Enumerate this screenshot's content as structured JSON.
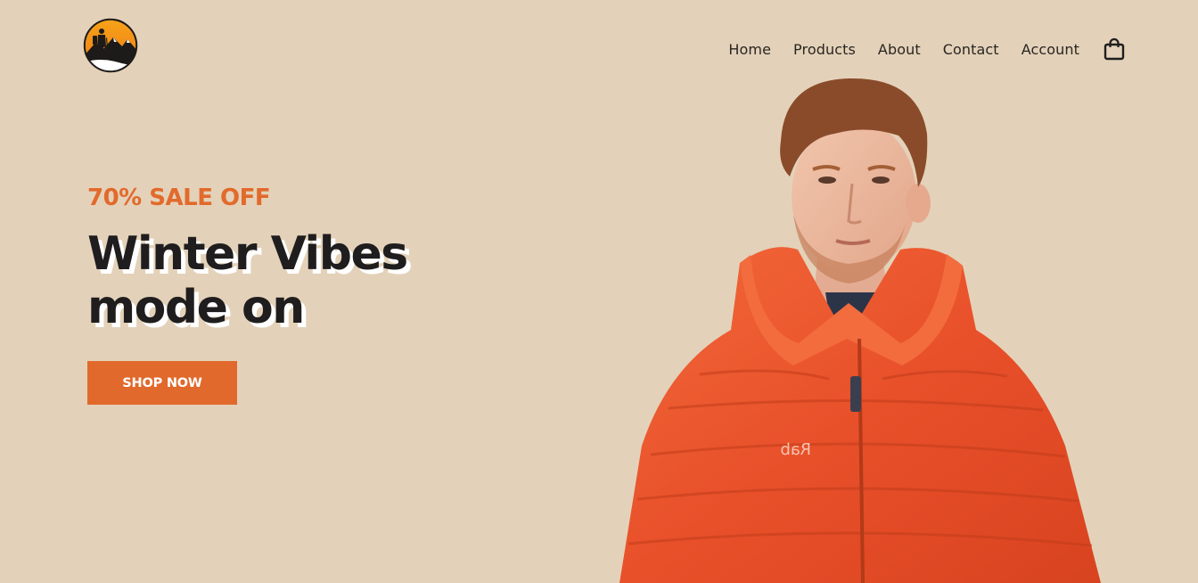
{
  "header": {
    "logo_alt": "hiker-mountain-logo",
    "nav": [
      {
        "label": "Home"
      },
      {
        "label": "Products"
      },
      {
        "label": "About"
      },
      {
        "label": "Contact"
      },
      {
        "label": "Account"
      }
    ],
    "cart_icon": "shopping-bag-icon"
  },
  "hero": {
    "sale_text": "70% SALE OFF",
    "headline_line1": "Winter Vibes",
    "headline_line2": "mode on",
    "cta_label": "SHOP NOW",
    "jacket_brand": "Rab"
  },
  "colors": {
    "background": "#e3d2b9",
    "accent": "#e1692b",
    "text": "#1f1d1e",
    "jacket": "#e8522a"
  }
}
